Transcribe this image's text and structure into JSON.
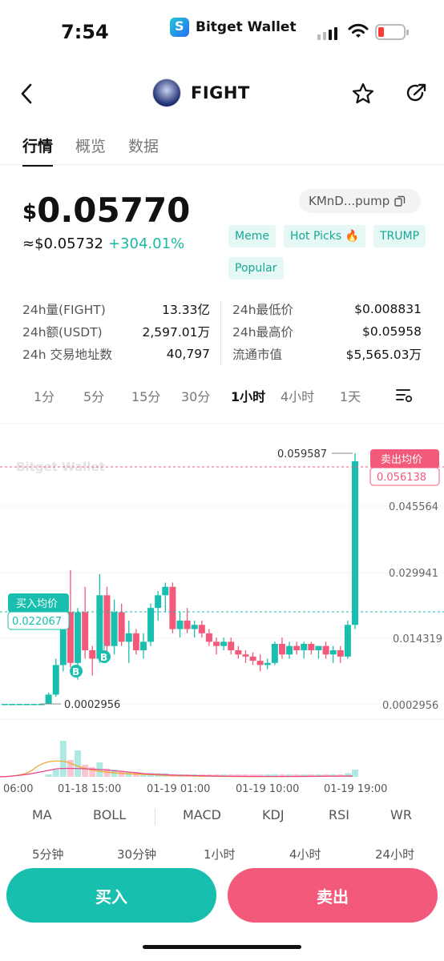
{
  "status": {
    "time": "7:54",
    "app_name": "Bitget Wallet"
  },
  "nav": {
    "title": "FIGHT"
  },
  "tabs": [
    "行情",
    "概览",
    "数据"
  ],
  "price": {
    "currency": "$",
    "value": "0.05770",
    "approx": "≈$0.05732",
    "change": "+304.01%"
  },
  "address": "KMnD...pump",
  "tags": [
    "Meme",
    "Hot Picks 🔥",
    "TRUMP",
    "Popular"
  ],
  "stats_left": [
    {
      "k": "24h量(FIGHT)",
      "v": "13.33亿"
    },
    {
      "k": "24h额(USDT)",
      "v": "2,597.01万"
    },
    {
      "k": "24h 交易地址数",
      "v": "40,797"
    }
  ],
  "stats_right": [
    {
      "k": "24h最低价",
      "v": "$0.008831"
    },
    {
      "k": "24h最高价",
      "v": "$0.05958"
    },
    {
      "k": "流通市值",
      "v": "$5,565.03万"
    }
  ],
  "intervals": [
    "1分",
    "5分",
    "15分",
    "30分",
    "1小时",
    "4小时",
    "1天"
  ],
  "active_interval": "1小时",
  "chart": {
    "watermark": "Bitget Wallet",
    "y_labels": [
      "0.045564",
      "0.029941",
      "0.014319",
      "0.0002956"
    ],
    "high_label": "0.059587",
    "low_label": "0.0002956",
    "sell_avg_label": "卖出均价",
    "sell_avg_value": "0.056138",
    "buy_avg_label": "买入均价",
    "buy_avg_value": "0.022067",
    "marker_b": "B",
    "x_labels": [
      "06:00",
      "01-18 15:00",
      "01-19 01:00",
      "01-19 10:00",
      "01-19 19:00"
    ],
    "colors": {
      "up": "#19bfae",
      "down": "#f2597a"
    }
  },
  "chart_data": {
    "type": "candlestick",
    "ylim": [
      0.0002956,
      0.059587
    ],
    "candles": [
      {
        "o": 0.0003,
        "h": 0.0003,
        "l": 0.0003,
        "c": 0.0003
      },
      {
        "o": 0.0003,
        "h": 0.0003,
        "l": 0.0003,
        "c": 0.0003
      },
      {
        "o": 0.0003,
        "h": 0.0003,
        "l": 0.0003,
        "c": 0.0003
      },
      {
        "o": 0.0003,
        "h": 0.0003,
        "l": 0.0003,
        "c": 0.0003
      },
      {
        "o": 0.0003,
        "h": 0.0003,
        "l": 0.0003,
        "c": 0.0003
      },
      {
        "o": 0.0003,
        "h": 0.0003,
        "l": 0.0003,
        "c": 0.0003
      },
      {
        "o": 0.0003,
        "h": 0.003,
        "l": 0.0002,
        "c": 0.0025
      },
      {
        "o": 0.0025,
        "h": 0.011,
        "l": 0.002,
        "c": 0.0095
      },
      {
        "o": 0.0095,
        "h": 0.023,
        "l": 0.008,
        "c": 0.022
      },
      {
        "o": 0.022,
        "h": 0.032,
        "l": 0.009,
        "c": 0.01
      },
      {
        "o": 0.01,
        "h": 0.023,
        "l": 0.006,
        "c": 0.022
      },
      {
        "o": 0.022,
        "h": 0.028,
        "l": 0.011,
        "c": 0.013
      },
      {
        "o": 0.013,
        "h": 0.014,
        "l": 0.007,
        "c": 0.011
      },
      {
        "o": 0.011,
        "h": 0.031,
        "l": 0.01,
        "c": 0.026
      },
      {
        "o": 0.026,
        "h": 0.028,
        "l": 0.012,
        "c": 0.014
      },
      {
        "o": 0.014,
        "h": 0.025,
        "l": 0.012,
        "c": 0.022
      },
      {
        "o": 0.022,
        "h": 0.024,
        "l": 0.014,
        "c": 0.015
      },
      {
        "o": 0.015,
        "h": 0.02,
        "l": 0.01,
        "c": 0.017
      },
      {
        "o": 0.017,
        "h": 0.018,
        "l": 0.012,
        "c": 0.013
      },
      {
        "o": 0.013,
        "h": 0.017,
        "l": 0.011,
        "c": 0.015
      },
      {
        "o": 0.015,
        "h": 0.024,
        "l": 0.014,
        "c": 0.023
      },
      {
        "o": 0.023,
        "h": 0.027,
        "l": 0.02,
        "c": 0.026
      },
      {
        "o": 0.026,
        "h": 0.029,
        "l": 0.022,
        "c": 0.028
      },
      {
        "o": 0.028,
        "h": 0.029,
        "l": 0.017,
        "c": 0.018
      },
      {
        "o": 0.018,
        "h": 0.022,
        "l": 0.016,
        "c": 0.02
      },
      {
        "o": 0.02,
        "h": 0.023,
        "l": 0.017,
        "c": 0.018
      },
      {
        "o": 0.018,
        "h": 0.02,
        "l": 0.016,
        "c": 0.019
      },
      {
        "o": 0.019,
        "h": 0.02,
        "l": 0.016,
        "c": 0.017
      },
      {
        "o": 0.017,
        "h": 0.018,
        "l": 0.014,
        "c": 0.015
      },
      {
        "o": 0.015,
        "h": 0.016,
        "l": 0.012,
        "c": 0.014
      },
      {
        "o": 0.014,
        "h": 0.016,
        "l": 0.013,
        "c": 0.015
      },
      {
        "o": 0.015,
        "h": 0.016,
        "l": 0.012,
        "c": 0.013
      },
      {
        "o": 0.013,
        "h": 0.014,
        "l": 0.011,
        "c": 0.012
      },
      {
        "o": 0.012,
        "h": 0.013,
        "l": 0.01,
        "c": 0.0115
      },
      {
        "o": 0.0115,
        "h": 0.0125,
        "l": 0.0095,
        "c": 0.0105
      },
      {
        "o": 0.0105,
        "h": 0.012,
        "l": 0.008,
        "c": 0.0095
      },
      {
        "o": 0.0095,
        "h": 0.011,
        "l": 0.0085,
        "c": 0.01
      },
      {
        "o": 0.01,
        "h": 0.015,
        "l": 0.0095,
        "c": 0.0145
      },
      {
        "o": 0.0145,
        "h": 0.016,
        "l": 0.011,
        "c": 0.012
      },
      {
        "o": 0.012,
        "h": 0.015,
        "l": 0.011,
        "c": 0.014
      },
      {
        "o": 0.014,
        "h": 0.015,
        "l": 0.012,
        "c": 0.013
      },
      {
        "o": 0.013,
        "h": 0.015,
        "l": 0.011,
        "c": 0.0145
      },
      {
        "o": 0.0145,
        "h": 0.015,
        "l": 0.012,
        "c": 0.013
      },
      {
        "o": 0.013,
        "h": 0.014,
        "l": 0.011,
        "c": 0.014
      },
      {
        "o": 0.014,
        "h": 0.015,
        "l": 0.011,
        "c": 0.012
      },
      {
        "o": 0.012,
        "h": 0.014,
        "l": 0.01,
        "c": 0.013
      },
      {
        "o": 0.013,
        "h": 0.014,
        "l": 0.01,
        "c": 0.0115
      },
      {
        "o": 0.0115,
        "h": 0.02,
        "l": 0.011,
        "c": 0.019
      },
      {
        "o": 0.019,
        "h": 0.0596,
        "l": 0.018,
        "c": 0.0577
      }
    ]
  },
  "indicators": [
    "MA",
    "BOLL",
    "MACD",
    "KDJ",
    "RSI",
    "WR"
  ],
  "periods": [
    "5分钟",
    "30分钟",
    "1小时",
    "4小时",
    "24小时"
  ],
  "actions": {
    "buy": "买入",
    "sell": "卖出"
  }
}
